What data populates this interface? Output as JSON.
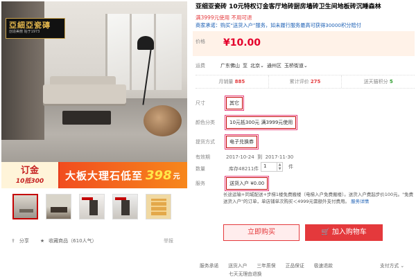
{
  "gallery": {
    "brand_logo_text": "亞細亞瓷磚",
    "brand_logo_sub": "创造美丽  始于1973",
    "promo_line1": "订金",
    "promo_line2": "10抵300",
    "promo_text": "大板大理石低至",
    "promo_price": "398",
    "promo_unit": "元",
    "thumbnails": [
      "thumb-1",
      "thumb-2",
      "thumb-3",
      "thumb-4",
      "thumb-5"
    ],
    "share_label": "分享",
    "favorite_label": "收藏商品（610人气）",
    "report_label": "举报"
  },
  "product": {
    "title": "亚细亚瓷砖 10元特权订金客厅地砖厨房墙砖卫生间地板砖沉睡森林",
    "subtitle": "满3999元使用 不用可退",
    "promise": "商家承诺：购买“送货入户”服务，如未履行服务最高可获得30000积分赔付"
  },
  "price": {
    "label": "价格",
    "value": "¥10.00"
  },
  "delivery": {
    "label": "运费",
    "from": "广东佛山",
    "to_word": "至",
    "city": "北京",
    "district": "通州区",
    "street": "玉桥街道"
  },
  "stats": {
    "sales_label": "月销量",
    "sales_value": "885",
    "reviews_label": "累计评价",
    "reviews_value": "275",
    "points_label": "送天猫积分",
    "points_value": "5"
  },
  "options": {
    "size_label": "尺寸",
    "size_value": "其它",
    "color_label": "颜色分类",
    "color_value": "10元抵300元 满3999元使用",
    "pickup_label": "提货方式",
    "pickup_value": "电子兑换券",
    "validity_label": "有效期",
    "validity_value": "2017-10-24  到  2017-11-30",
    "qty_label": "数量",
    "stock_text": "库存48211件",
    "qty_value": "1",
    "qty_unit": "件",
    "service_label": "服务",
    "service_value": "送货入户 ¥0.00"
  },
  "service_desc": {
    "text": "长途运输+同城配送+步梯1楼免费搬楼（电梯入户免费搬楼）。送货入户费起步价100元。\"免费送货入户\"的订单，单店铺单次购买＜4999元需额外支付费用。",
    "more": "服务详情"
  },
  "actions": {
    "buy_now": "立即购买",
    "add_cart": "加入购物车"
  },
  "footer": {
    "links": [
      "服务承诺",
      "送货入户",
      "三年质保",
      "正品保证",
      "极速退款"
    ],
    "extra": "七天无理由退换",
    "pay_methods": "支付方式"
  },
  "colors": {
    "accent": "#e4393c",
    "link": "#1b5fb4",
    "price_bg": "#fff2e8",
    "promo_orange": "#f14d1f"
  }
}
